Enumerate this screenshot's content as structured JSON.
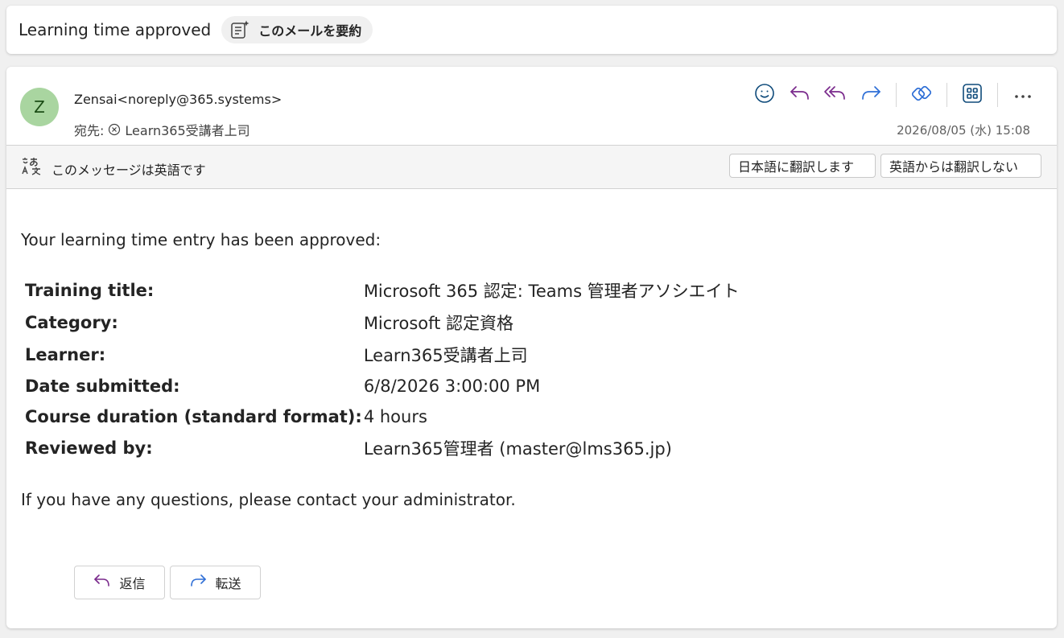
{
  "subject": {
    "title": "Learning time approved",
    "summarize_label": "このメールを要約"
  },
  "header": {
    "avatar_initial": "Z",
    "sender": "Zensai<noreply@365.systems>",
    "to_label": "宛先:",
    "recipient": "Learn365受講者上司",
    "date": "2026/08/05 (水) 15:08",
    "actions": [
      "emoji-icon",
      "reply-icon",
      "reply-all-icon",
      "forward-icon",
      "loop-icon",
      "apps-icon",
      "more-icon"
    ]
  },
  "translation": {
    "message": "このメッセージは英語です",
    "translate_button": "日本語に翻訳します",
    "never_translate_button": "英語からは翻訳しない"
  },
  "body": {
    "intro": "Your learning time entry has been approved:",
    "rows": [
      {
        "label": "Training title:",
        "value": "Microsoft 365 認定: Teams 管理者アソシエイト"
      },
      {
        "label": "Category:",
        "value": "Microsoft 認定資格"
      },
      {
        "label": "Learner:",
        "value": "Learn365受講者上司"
      },
      {
        "label": "Date submitted:",
        "value": "6/8/2026 3:00:00 PM"
      },
      {
        "label": "Course duration (standard format):",
        "value": "4 hours"
      },
      {
        "label": "Reviewed by:",
        "value": "Learn365管理者 (master@lms365.jp)"
      }
    ],
    "outro": "If you have any questions, please contact your administrator."
  },
  "footer": {
    "reply_label": "返信",
    "forward_label": "転送"
  },
  "colors": {
    "reply_purple": "#7a2a8c",
    "forward_blue": "#2f6fd6",
    "accent_blue": "#0f6cbd",
    "avatar_bg": "#a9d5a0"
  }
}
